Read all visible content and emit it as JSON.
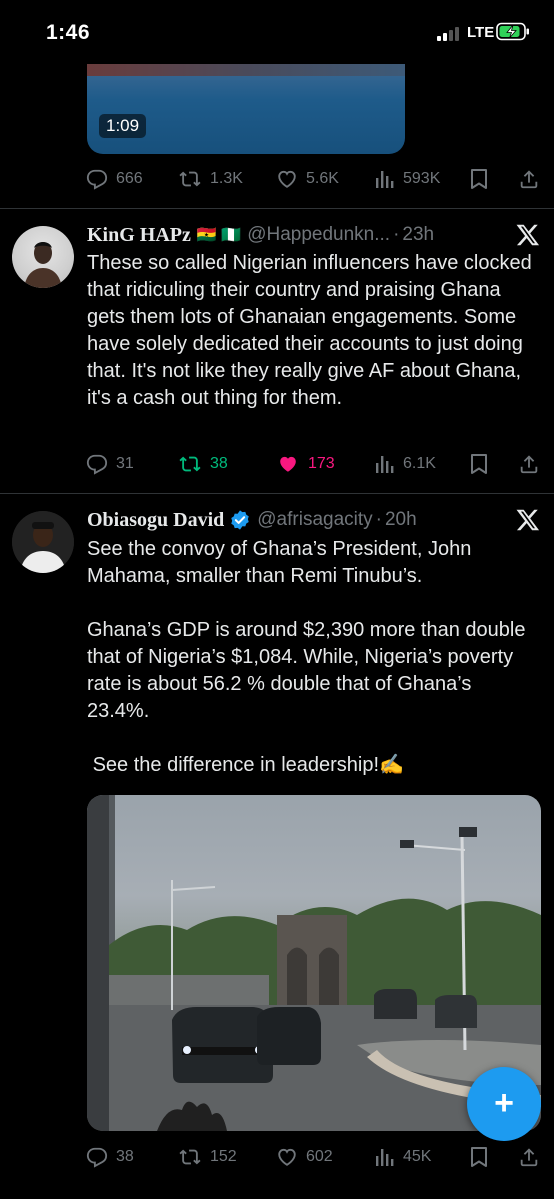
{
  "status_bar": {
    "time": "1:46",
    "network": "LTE"
  },
  "tweets": [
    {
      "id": "prev",
      "video_duration": "1:09",
      "actions": {
        "replies": "666",
        "reposts": "1.3K",
        "likes": "5.6K",
        "views": "593K"
      }
    },
    {
      "id": "kinghapz",
      "display_name": "KinG HAPz",
      "flags": "🇬🇭 🇳🇬",
      "handle": "@Happedunkn...",
      "time": "23h",
      "text": "These so called Nigerian influencers have clocked that ridiculing their country and praising Ghana gets them lots of Ghanaian engagements. Some have solely dedicated their accounts to just doing that. It's not like they really give AF about Ghana, it's a cash out thing for them.",
      "actions": {
        "replies": "31",
        "reposts": "38",
        "likes": "173",
        "views": "6.1K"
      },
      "liked": true,
      "reposted": true
    },
    {
      "id": "obiasogu",
      "display_name": "Obiasogu David",
      "verified": true,
      "handle": "@afrisagacity",
      "time": "20h",
      "text": "See the convoy of Ghana’s President, John Mahama, smaller than Remi Tinubu’s.\n\nGhana’s GDP is around $2,390 more than double that of Nigeria’s $1,084. While, Nigeria’s poverty rate is about 56.2 % double that of Ghana’s 23.4%.\n\n See the difference in leadership!✍️",
      "actions": {
        "replies": "38",
        "reposts": "152",
        "likes": "602",
        "views": "45K"
      }
    }
  ],
  "fab": {
    "label": "+"
  },
  "colors": {
    "accent": "#1d9bf0",
    "like": "#f91880",
    "repost": "#00ba7c",
    "muted": "#71767b",
    "text": "#e7e9ea",
    "background": "#000000"
  },
  "icons": [
    "reply-icon",
    "repost-icon",
    "like-icon",
    "views-icon",
    "bookmark-icon",
    "share-icon",
    "x-logo-icon",
    "verified-icon",
    "compose-icon"
  ]
}
